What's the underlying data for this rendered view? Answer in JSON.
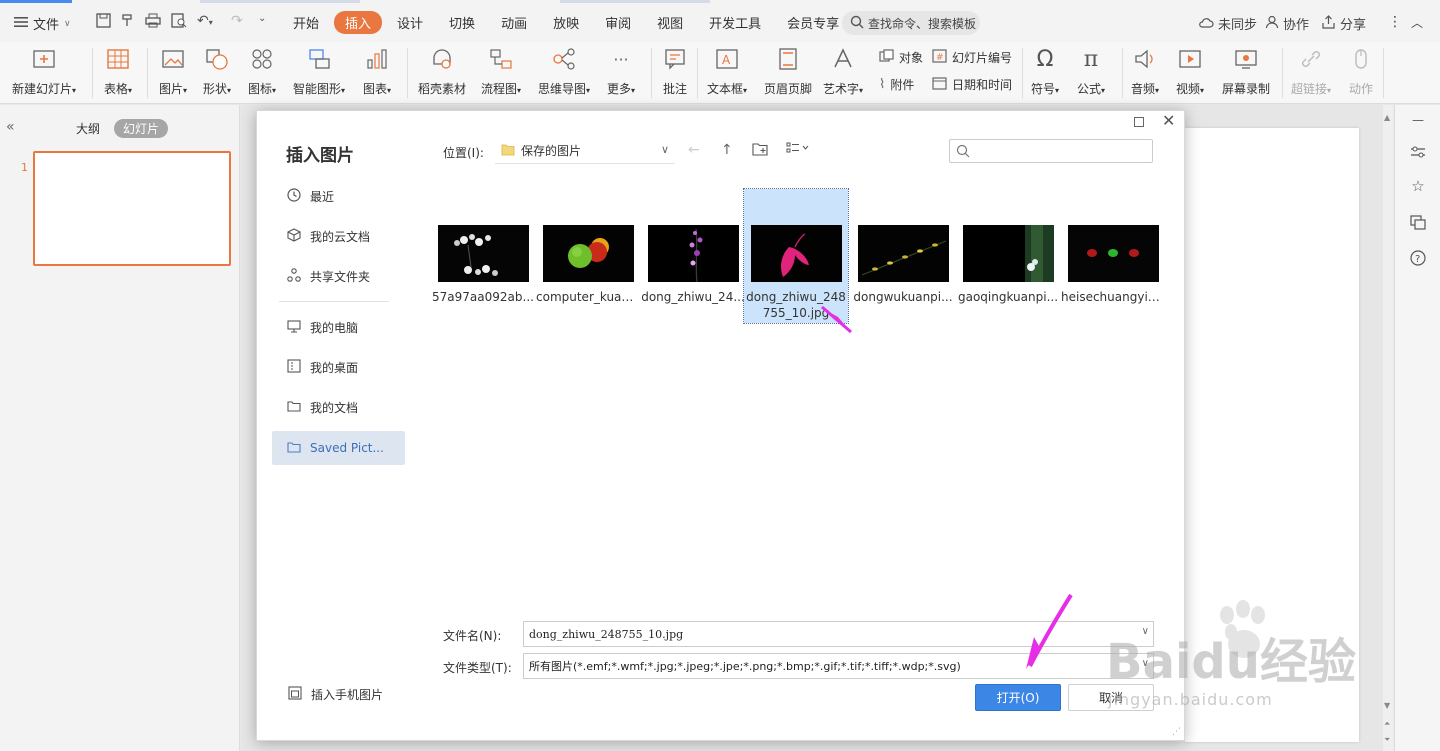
{
  "menu": {
    "file_label": "文件",
    "tabs": [
      {
        "label": "开始",
        "active": false
      },
      {
        "label": "插入",
        "active": true
      },
      {
        "label": "设计",
        "active": false
      },
      {
        "label": "切换",
        "active": false
      },
      {
        "label": "动画",
        "active": false
      },
      {
        "label": "放映",
        "active": false
      },
      {
        "label": "审阅",
        "active": false
      },
      {
        "label": "视图",
        "active": false
      },
      {
        "label": "开发工具",
        "active": false
      },
      {
        "label": "会员专享",
        "active": false
      }
    ],
    "search_label": "查找命令、搜索模板",
    "sync_label": "未同步",
    "collab_label": "协作",
    "share_label": "分享"
  },
  "ribbon": {
    "new_slide": "新建幻灯片",
    "table": "表格",
    "picture": "图片",
    "shape": "形状",
    "icon": "图标",
    "smartart": "智能图形",
    "chart": "图表",
    "material": "稻壳素材",
    "flowchart": "流程图",
    "mindmap": "思维导图",
    "more": "更多",
    "comment": "批注",
    "textbox": "文本框",
    "header_footer": "页眉页脚",
    "wordart": "艺术字",
    "object": "对象",
    "attachment": "附件",
    "slide_number": "幻灯片编号",
    "datetime": "日期和时间",
    "symbol": "符号",
    "formula": "公式",
    "audio": "音频",
    "video": "视频",
    "screen_record": "屏幕录制",
    "hyperlink": "超链接",
    "action": "动作"
  },
  "left_panel": {
    "outline_tab": "大纲",
    "slides_tab": "幻灯片",
    "slide_number": "1"
  },
  "dialog": {
    "title": "插入图片",
    "nav": {
      "recent": "最近",
      "cloud": "我的云文档",
      "shared": "共享文件夹",
      "computer": "我的电脑",
      "desktop": "我的桌面",
      "documents": "我的文档",
      "saved_pictures": "Saved Pict...",
      "phone_pictures": "插入手机图片"
    },
    "location_label": "位置(I):",
    "location_value": "保存的图片",
    "files": [
      {
        "name": "57a97aa092ab...",
        "selected": false
      },
      {
        "name": "computer_kuan...",
        "selected": false
      },
      {
        "name": "dong_zhiwu_24...",
        "selected": false
      },
      {
        "name": "dong_zhiwu_248755_10.jpg",
        "selected": true
      },
      {
        "name": "dongwukuanpi...",
        "selected": false
      },
      {
        "name": "gaoqingkuanpi...",
        "selected": false
      },
      {
        "name": "heisechuangyib...",
        "selected": false
      }
    ],
    "filename_label": "文件名(N):",
    "filename_value": "dong_zhiwu_248755_10.jpg",
    "filetype_label": "文件类型(T):",
    "filetype_value": "所有图片(*.emf;*.wmf;*.jpg;*.jpeg;*.jpe;*.png;*.bmp;*.gif;*.tif;*.tiff;*.wdp;*.svg)",
    "open_button": "打开(O)",
    "cancel_button": "取消"
  },
  "watermark": {
    "logo": "Baidu经验",
    "url": "jingyan.baidu.com"
  },
  "colors": {
    "accent_orange": "#e9773f",
    "primary_blue": "#3c87e6",
    "selection_blue": "#cce4fb",
    "annotation_magenta": "#e62ee6"
  }
}
